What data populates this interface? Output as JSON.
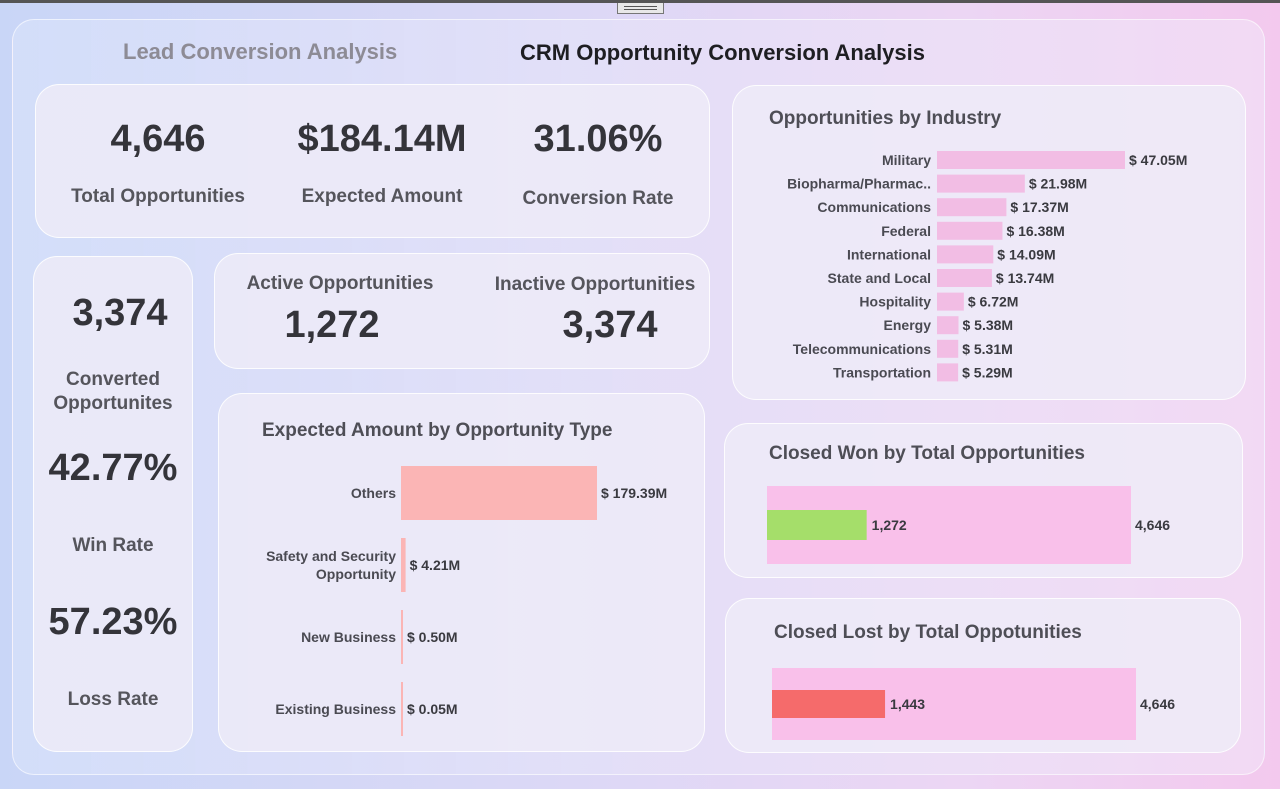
{
  "header": {
    "left_title": "Lead Conversion Analysis",
    "main_title": "CRM Opportunity Conversion Analysis"
  },
  "kpis": {
    "total_opportunities": {
      "value": "4,646",
      "label": "Total Opportunities"
    },
    "expected_amount": {
      "value": "$184.14M",
      "label": "Expected Amount"
    },
    "conversion_rate": {
      "value": "31.06%",
      "label": "Conversion Rate"
    }
  },
  "side": {
    "converted": {
      "value": "3,374",
      "label_line1": "Converted",
      "label_line2": "Opportunites"
    },
    "win_rate": {
      "value": "42.77%",
      "label": "Win Rate"
    },
    "loss_rate": {
      "value": "57.23%",
      "label": "Loss Rate"
    }
  },
  "activity": {
    "active": {
      "label": "Active Opportunities",
      "value": "1,272"
    },
    "inactive": {
      "label": "Inactive Opportunities",
      "value": "3,374"
    }
  },
  "colors": {
    "industry_bar": "#f2bde4",
    "type_bar": "#fbb5b5",
    "total_bar": "#f9c0ea",
    "won_bar": "#a5de6a",
    "lost_bar": "#f56b6b"
  },
  "chart_data": [
    {
      "type": "bar",
      "orientation": "horizontal",
      "title": "Opportunities by Industry",
      "categories": [
        "Military",
        "Biopharma/Pharmac..",
        "Communications",
        "Federal",
        "International",
        "State and Local",
        "Hospitality",
        "Energy",
        "Telecommunications",
        "Transportation"
      ],
      "values": [
        47.05,
        21.98,
        17.37,
        16.38,
        14.09,
        13.74,
        6.72,
        5.38,
        5.31,
        5.29
      ],
      "labels": [
        "$ 47.05M",
        "$ 21.98M",
        "$ 17.37M",
        "$ 16.38M",
        "$ 14.09M",
        "$ 13.74M",
        "$ 6.72M",
        "$ 5.38M",
        "$ 5.31M",
        "$ 5.29M"
      ]
    },
    {
      "type": "bar",
      "orientation": "horizontal",
      "title": "Expected Amount by Opportunity Type",
      "categories": [
        [
          "Others"
        ],
        [
          "Safety and Security",
          "Opportunity"
        ],
        [
          "New Business"
        ],
        [
          "Existing Business"
        ]
      ],
      "values": [
        179.39,
        4.21,
        0.5,
        0.05
      ],
      "labels": [
        "$ 179.39M",
        "$ 4.21M",
        "$ 0.50M",
        "$ 0.05M"
      ]
    },
    {
      "type": "bar",
      "orientation": "horizontal",
      "title": "Closed Won by Total Opportunities",
      "total": 4646,
      "value": 1272,
      "total_label": "4,646",
      "value_label": "1,272"
    },
    {
      "type": "bar",
      "orientation": "horizontal",
      "title": "Closed Lost by Total Oppotunities",
      "total": 4646,
      "value": 1443,
      "total_label": "4,646",
      "value_label": "1,443"
    }
  ]
}
